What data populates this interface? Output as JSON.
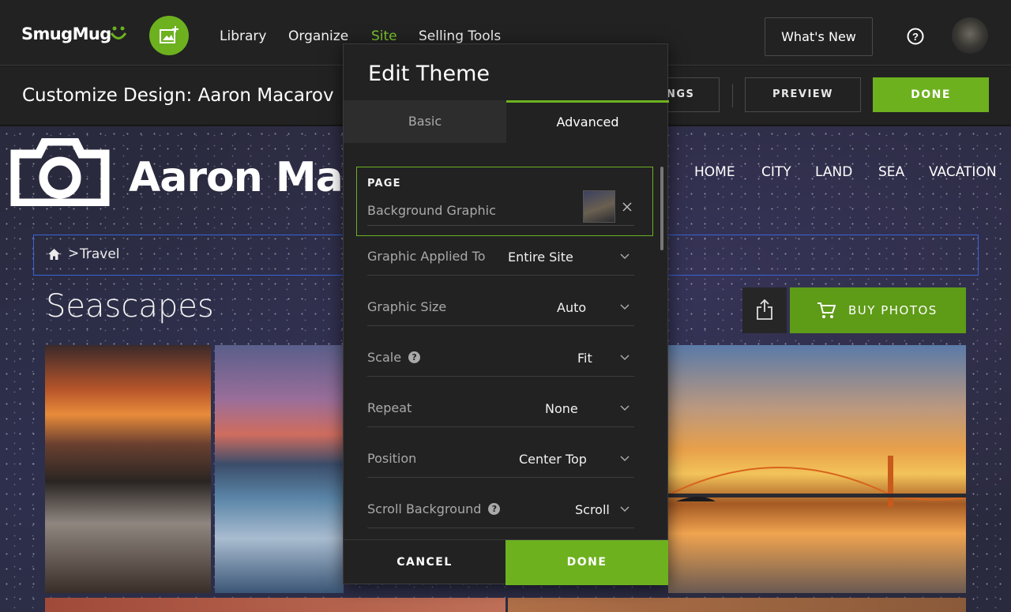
{
  "header": {
    "logo_text": "SmugMug",
    "nav": [
      "Library",
      "Organize",
      "Site",
      "Selling Tools"
    ],
    "active_nav": "Site",
    "whats_new": "What's New",
    "help_icon": "help-circle-icon",
    "upload_icon": "add-photo-icon"
  },
  "subheader": {
    "title": "Customize Design: Aaron Macarov",
    "settings_partial": "NGS",
    "preview": "PREVIEW",
    "done": "DONE"
  },
  "site": {
    "name": "Aaron Mac",
    "nav": [
      "HOME",
      "CITY",
      "LAND",
      "SEA",
      "VACATION"
    ],
    "breadcrumb": {
      "sep": ">",
      "item": "Travel"
    },
    "gallery_title": "Seascapes",
    "buy_photos": "BUY PHOTOS"
  },
  "modal": {
    "title": "Edit Theme",
    "tabs": [
      "Basic",
      "Advanced"
    ],
    "active_tab": "Advanced",
    "page_section": {
      "label": "PAGE",
      "field": "Background Graphic"
    },
    "rows": [
      {
        "label": "Graphic Applied To",
        "value": "Entire Site",
        "help": false
      },
      {
        "label": "Graphic Size",
        "value": "Auto",
        "help": false
      },
      {
        "label": "Scale",
        "value": "Fit",
        "help": true
      },
      {
        "label": "Repeat",
        "value": "None",
        "help": false
      },
      {
        "label": "Position",
        "value": "Center Top",
        "help": false
      },
      {
        "label": "Scroll Background",
        "value": "Scroll",
        "help": true
      }
    ],
    "help_glyph": "?",
    "cancel": "CANCEL",
    "done": "DONE"
  },
  "colors": {
    "accent": "#6db11f",
    "topbar": "#222223",
    "breadcrumb_border": "#3a63d6"
  }
}
